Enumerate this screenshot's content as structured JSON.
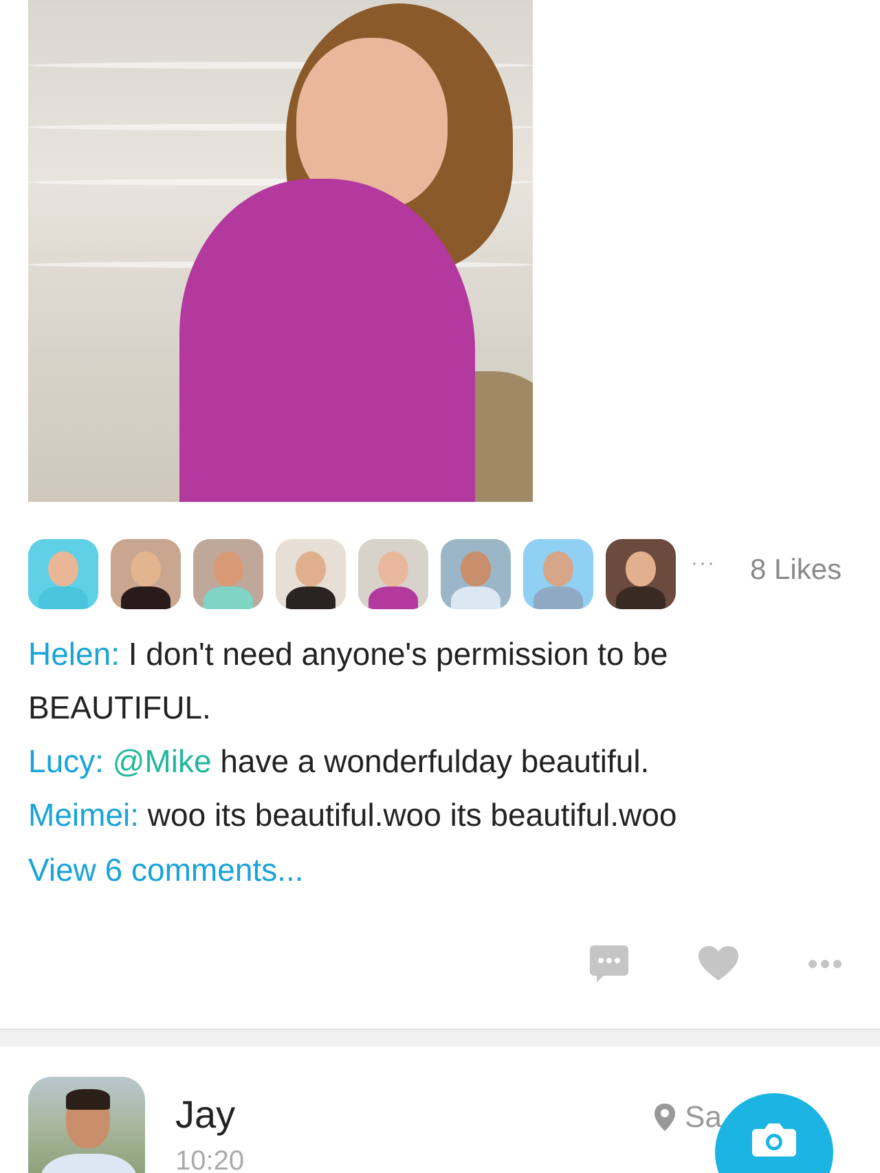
{
  "post": {
    "likes": {
      "ellipsis": "···",
      "count_label": "8 Likes",
      "avatars": [
        {
          "name": "liker-1",
          "bg": "#5fd0e6",
          "head": "#e9b796",
          "torso": "#49c6de"
        },
        {
          "name": "liker-2",
          "bg": "#c9a690",
          "head": "#e2b58f",
          "torso": "#2a1b1b"
        },
        {
          "name": "liker-3",
          "bg": "#bfa79a",
          "head": "#d89a76",
          "torso": "#7fd4c4"
        },
        {
          "name": "liker-4",
          "bg": "#e7dfd6",
          "head": "#e0b08e",
          "torso": "#2b2321"
        },
        {
          "name": "liker-5",
          "bg": "#d7d3cb",
          "head": "#e9b79c",
          "torso": "#b3399e"
        },
        {
          "name": "liker-6",
          "bg": "#9bb7c7",
          "head": "#c98f6c",
          "torso": "#dbe8f4"
        },
        {
          "name": "liker-7",
          "bg": "#8fd0f3",
          "head": "#d7a587",
          "torso": "#8fa8c4"
        },
        {
          "name": "liker-8",
          "bg": "#6b4b3e",
          "head": "#e2b08f",
          "torso": "#3a2a24"
        }
      ]
    },
    "comments": [
      {
        "author": "Helen:",
        "mention": "",
        "text": " I don't need anyone's permission to be BEAUTIFUL."
      },
      {
        "author": "Lucy:",
        "mention": "@Mike",
        "text": " have a wonderfulday beautiful."
      },
      {
        "author": "Meimei:",
        "mention": "",
        "text": "  woo its beautiful.woo its beautiful.woo"
      }
    ],
    "view_comments": "View 6 comments..."
  },
  "actions": {
    "comment_icon": "chat-bubble-icon",
    "like_icon": "heart-icon",
    "more_icon": "more-dots-icon",
    "icon_color": "#c5c5c5"
  },
  "next_post": {
    "author": "Jay",
    "time": "10:20",
    "location": "Sa        go"
  },
  "fab": {
    "icon": "camera-icon",
    "color": "#1cb4e2"
  }
}
